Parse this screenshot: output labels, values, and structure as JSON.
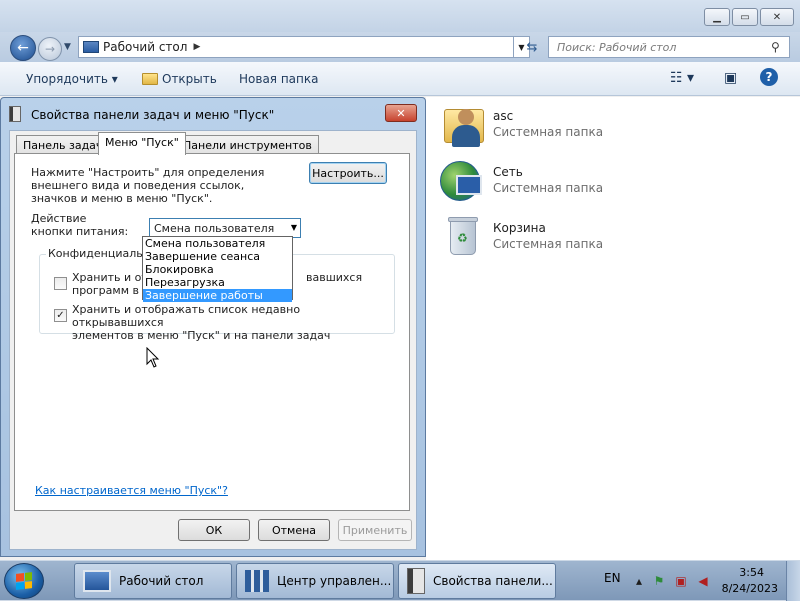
{
  "explorer": {
    "address": "Рабочий стол",
    "search_placeholder": "Поиск: Рабочий стол",
    "toolbar": {
      "organize": "Упорядочить ▾",
      "open": "Открыть",
      "new_folder": "Новая папка"
    },
    "items": [
      {
        "name": "asc",
        "type": "Системная папка",
        "icon": "user-folder-icon"
      },
      {
        "name": "Сеть",
        "type": "Системная папка",
        "icon": "network-icon"
      },
      {
        "name": "Корзина",
        "type": "Системная папка",
        "icon": "recycle-bin-icon"
      }
    ]
  },
  "dialog": {
    "title": "Свойства панели задач и меню \"Пуск\"",
    "tabs": [
      "Панель задач",
      "Меню \"Пуск\"",
      "Панели инструментов"
    ],
    "active_tab": 1,
    "description": "Нажмите \"Настроить\" для определения внешнего вида и поведения ссылок, значков и меню в меню \"Пуск\".",
    "customize_button": "Настроить...",
    "power_label": "Действие кнопки питания:",
    "power_selected": "Смена пользователя",
    "power_options": [
      "Смена пользователя",
      "Завершение сеанса",
      "Блокировка",
      "Перезагрузка",
      "Завершение работы"
    ],
    "highlighted_option": 4,
    "privacy_group": "Конфиденциальност",
    "privacy_options": [
      {
        "label_line1": "Хранить и отобра",
        "label_line1_tail": "вавшихся",
        "label_line2": "программ в меню",
        "checked": false
      },
      {
        "label_line1": "Хранить и отображать список недавно открывавшихся",
        "label_line2": "элементов в меню \"Пуск\" и на панели задач",
        "checked": true
      }
    ],
    "help_link": "Как настраивается меню \"Пуск\"?",
    "ok": "ОК",
    "cancel": "Отмена",
    "apply": "Применить"
  },
  "taskbar": {
    "tasks": [
      {
        "label": "Рабочий стол",
        "icon": "desktop-icon"
      },
      {
        "label": "Центр управлен...",
        "icon": "network-center-icon"
      },
      {
        "label": "Свойства панели...",
        "icon": "taskbar-properties-icon"
      }
    ],
    "language": "EN",
    "time": "3:54",
    "date": "8/24/2023"
  }
}
